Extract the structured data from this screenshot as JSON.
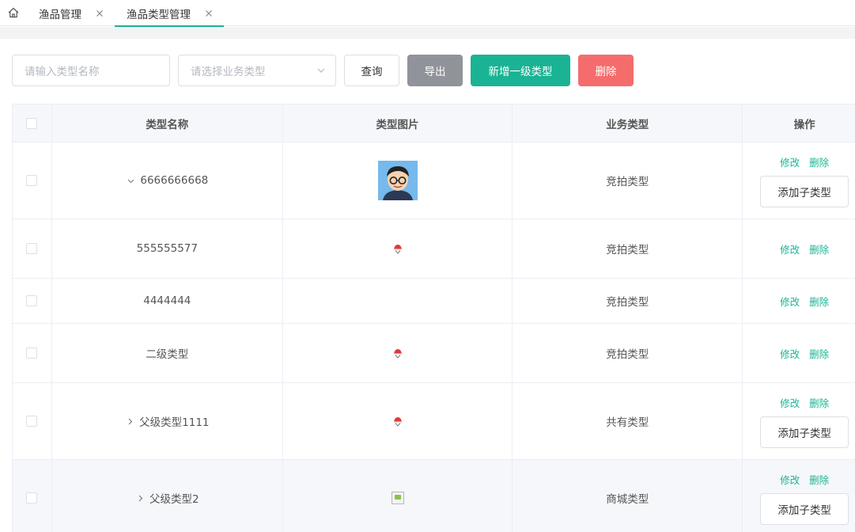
{
  "tabs": [
    {
      "label": "渔品管理",
      "active": false
    },
    {
      "label": "渔品类型管理",
      "active": true
    }
  ],
  "toolbar": {
    "name_placeholder": "请输入类型名称",
    "biz_placeholder": "请选择业务类型",
    "query": "查询",
    "export": "导出",
    "add_top": "新增一级类型",
    "delete": "删除"
  },
  "table": {
    "headers": {
      "name": "类型名称",
      "image": "类型图片",
      "biz": "业务类型",
      "ops": "操作"
    },
    "ops": {
      "edit": "修改",
      "delete": "删除",
      "add_child": "添加子类型"
    },
    "rows": [
      {
        "name": "6666666668",
        "biz": "竞拍类型",
        "tree": "expanded",
        "image": "avatar-cartoon",
        "add_child": true
      },
      {
        "name": "555555577",
        "biz": "竞拍类型",
        "tree": "none",
        "image": "hat-icon",
        "add_child": false
      },
      {
        "name": "4444444",
        "biz": "竞拍类型",
        "tree": "none",
        "image": "none",
        "add_child": false
      },
      {
        "name": "二级类型",
        "biz": "竞拍类型",
        "tree": "none",
        "image": "hat-icon",
        "add_child": false
      },
      {
        "name": "父级类型1111",
        "biz": "共有类型",
        "tree": "collapsed",
        "image": "hat-icon",
        "add_child": true
      },
      {
        "name": "父级类型2",
        "biz": "商城类型",
        "tree": "collapsed",
        "image": "broken-image",
        "add_child": true
      }
    ]
  },
  "colors": {
    "primary": "#1ab394",
    "danger": "#f56c6c",
    "info": "#909399"
  }
}
